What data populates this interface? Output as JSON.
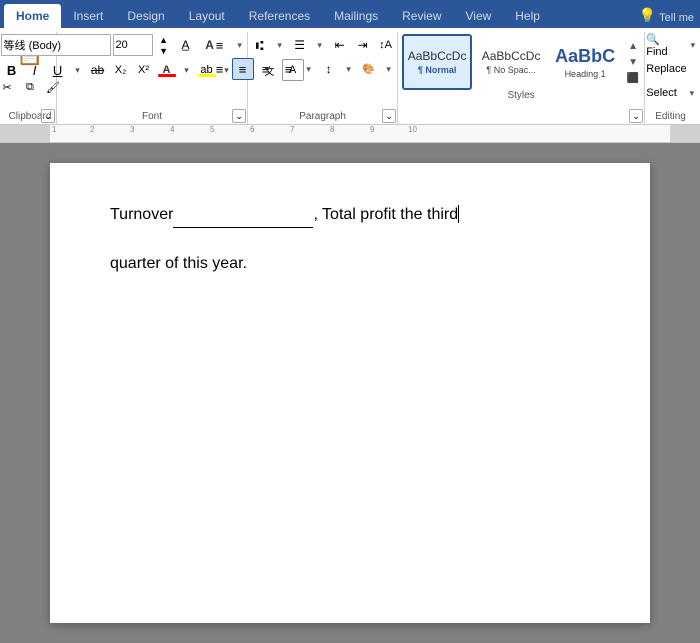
{
  "tabs": [
    {
      "id": "home",
      "label": "Home",
      "active": true
    },
    {
      "id": "insert",
      "label": "Insert",
      "active": false
    },
    {
      "id": "design",
      "label": "Design",
      "active": false
    },
    {
      "id": "layout",
      "label": "Layout",
      "active": false
    },
    {
      "id": "references",
      "label": "References",
      "active": false
    },
    {
      "id": "mailings",
      "label": "Mailings",
      "active": false
    },
    {
      "id": "review",
      "label": "Review",
      "active": false
    },
    {
      "id": "view",
      "label": "View",
      "active": false
    },
    {
      "id": "help",
      "label": "Help",
      "active": false
    }
  ],
  "tellme": {
    "icon": "💡",
    "placeholder": "Tell me"
  },
  "font": {
    "name": "等线 (Body)",
    "size": "20",
    "bold": false,
    "italic": false,
    "underline": false,
    "strikethrough": false,
    "subscript": false,
    "superscript": false
  },
  "styles": {
    "items": [
      {
        "id": "normal",
        "preview": "AaBbCcDc",
        "label": "¶ Normal",
        "active": true
      },
      {
        "id": "nospace",
        "preview": "AaBbCcDc",
        "label": "¶ No Spac...",
        "active": false
      },
      {
        "id": "heading1",
        "preview": "AaBbC",
        "label": "Heading 1",
        "active": false,
        "isHeading": true
      }
    ]
  },
  "groups": {
    "font_label": "Font",
    "paragraph_label": "Paragraph",
    "styles_label": "Styles"
  },
  "document": {
    "text_line1": "Turnover",
    "blank": "",
    "text_line1b": "$,  Total profit the third",
    "text_line2": "quarter of this year.",
    "cursor_after": "third"
  },
  "colors": {
    "ribbon_blue": "#2b579a",
    "active_tab_bg": "#ffffff",
    "doc_bg": "#808080",
    "page_bg": "#ffffff"
  }
}
